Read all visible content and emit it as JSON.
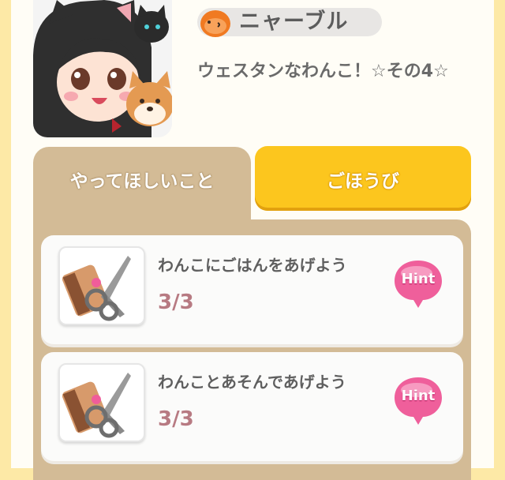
{
  "header": {
    "npc_name": "ニャーブル",
    "quest_title": "ウェスタンなわんこ！☆その4☆"
  },
  "tabs": {
    "requests_label": "やってほしいこと",
    "reward_label": "ごほうび"
  },
  "tasks": [
    {
      "label": "わんこにごはんをあげよう",
      "progress": "3/3",
      "hint_label": "Hint"
    },
    {
      "label": "わんことあそんであげよう",
      "progress": "3/3",
      "hint_label": "Hint"
    }
  ],
  "colors": {
    "tab_active": "#d3bb96",
    "tab_reward": "#fcc61e",
    "progress_text": "#b77a82",
    "hint_pink": "#ef5f9b"
  },
  "icons": {
    "npc_face": "orange-blob-icon",
    "task_thumbnail": "brush-and-scissors-icon",
    "hint": "pink-speech-bubble-icon"
  }
}
